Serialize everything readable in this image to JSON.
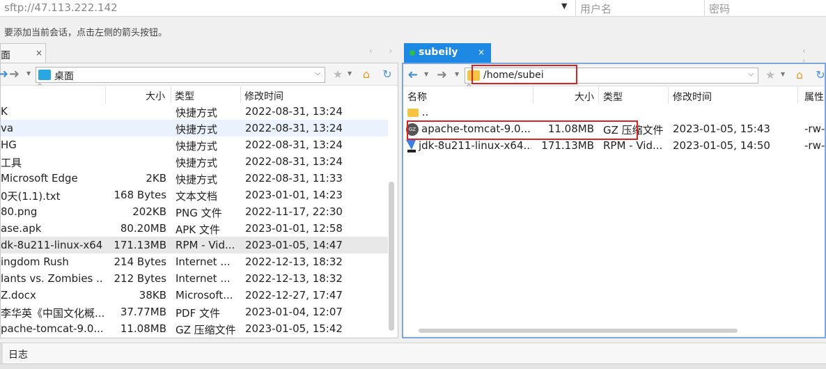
{
  "connection": {
    "host": "sftp://47.113.222.142",
    "username_placeholder": "用户名",
    "password_placeholder": "密码",
    "hint": "要添加当前会话，点击左侧的箭头按钮。"
  },
  "tabs": {
    "left_label": "面",
    "left_close": "×",
    "right_label": "subeily",
    "right_close": "×"
  },
  "local": {
    "path": "桌面",
    "columns": {
      "size": "大小",
      "type": "类型",
      "modified": "修改时间"
    },
    "rows": [
      {
        "name": "K",
        "size": "",
        "type": "快捷方式",
        "modified": "2022-08-31, 13:24"
      },
      {
        "name": "va",
        "size": "",
        "type": "快捷方式",
        "modified": "2022-08-31, 13:24"
      },
      {
        "name": "HG",
        "size": "",
        "type": "快捷方式",
        "modified": "2022-08-31, 13:24"
      },
      {
        "name": "工具",
        "size": "",
        "type": "快捷方式",
        "modified": "2022-08-31, 13:24"
      },
      {
        "name": "Microsoft Edge",
        "size": "2KB",
        "type": "快捷方式",
        "modified": "2022-08-31, 11:33"
      },
      {
        "name": "0天(1.1).txt",
        "size": "168 Bytes",
        "type": "文本文档",
        "modified": "2023-01-01, 14:23"
      },
      {
        "name": "80.png",
        "size": "202KB",
        "type": "PNG 文件",
        "modified": "2022-11-17, 22:30"
      },
      {
        "name": "ase.apk",
        "size": "80.20MB",
        "type": "APK 文件",
        "modified": "2023-01-01, 12:58"
      },
      {
        "name": "dk-8u211-linux-x64....",
        "size": "171.13MB",
        "type": "RPM - Vid...",
        "modified": "2023-01-05, 14:47"
      },
      {
        "name": "ingdom Rush",
        "size": "214 Bytes",
        "type": "Internet ...",
        "modified": "2022-12-13, 18:32"
      },
      {
        "name": "lants vs. Zombies ...",
        "size": "212 Bytes",
        "type": "Internet ...",
        "modified": "2022-12-13, 18:32"
      },
      {
        "name": "Z.docx",
        "size": "38KB",
        "type": "Microsoft...",
        "modified": "2022-12-27, 17:47"
      },
      {
        "name": "李华英《中国文化概...",
        "size": "37.77MB",
        "type": "PDF 文件",
        "modified": "2023-01-04, 12:07"
      },
      {
        "name": "pache-tomcat-9.0....",
        "size": "11.08MB",
        "type": "GZ 压缩文件",
        "modified": "2023-01-05, 15:42"
      }
    ]
  },
  "remote": {
    "path": "/home/subei",
    "columns": {
      "name": "名称",
      "size": "大小",
      "type": "类型",
      "modified": "修改时间",
      "attrs": "属性"
    },
    "parent_dir": "..",
    "rows": [
      {
        "name": "apache-tomcat-9.0....",
        "size": "11.08MB",
        "type": "GZ 压缩文件",
        "modified": "2023-01-05, 15:43",
        "attrs": "-rw-r",
        "icon": "gz-archive-icon"
      },
      {
        "name": "jdk-8u211-linux-x64....",
        "size": "171.13MB",
        "type": "RPM - Vid...",
        "modified": "2023-01-05, 14:50",
        "attrs": "-rw-r",
        "icon": "rpm-file-icon"
      }
    ]
  },
  "log": {
    "label": "日志"
  },
  "colors": {
    "accent": "#1e88e5",
    "highlight": "#e02020",
    "online": "#2fbf46"
  }
}
